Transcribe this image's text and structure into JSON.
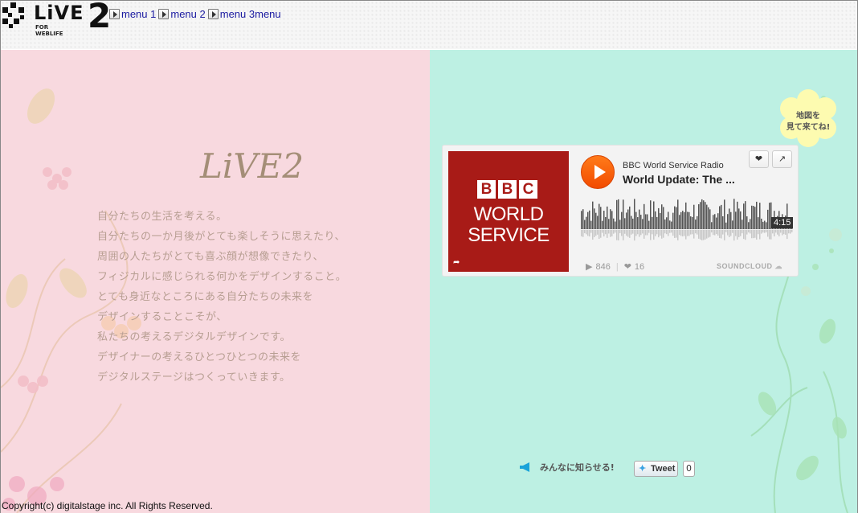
{
  "logo": {
    "live": "LiVE",
    "two": "2",
    "tagline": "FOR WEBLIFE"
  },
  "nav": [
    {
      "label": "menu 1"
    },
    {
      "label": "menu 2"
    },
    {
      "label": "menu 3menu"
    }
  ],
  "main": {
    "title": "LiVE2",
    "intro": [
      "自分たちの生活を考える。",
      "自分たちの一か月後がとても楽しそうに思えたり、",
      "周囲の人たちがとても喜ぶ顔が想像できたり、",
      "フィジカルに感じられる何かをデザインすること。",
      "とても身近なところにある自分たちの未来を",
      "デザインすることこそが、",
      "私たちの考えるデジタルデザインです。",
      "デザイナーの考えるひとつひとつの未来を",
      "デジタルステージはつくっていきます。"
    ]
  },
  "map_badge": {
    "line1": "地図を",
    "line2": "見て来てね!"
  },
  "player": {
    "artwork": {
      "bbc": [
        "B",
        "B",
        "C"
      ],
      "line1": "WORLD",
      "line2": "SERVICE"
    },
    "uploader": "BBC World Service Radio",
    "track_title": "World Update: The ...",
    "duration": "4:15",
    "plays": "846",
    "likes": "16",
    "brand": "SOUNDCLOUD",
    "played_fraction": 0
  },
  "social": {
    "share_label": "みんなに知らせる!",
    "tweet_label": "Tweet",
    "tweet_count": "0"
  },
  "footer": {
    "copyright": "Copyright(c) digitalstage inc. All Rights Reserved."
  },
  "colors": {
    "left_bg": "#f8d9df",
    "right_bg": "#bdf0e3",
    "soundcloud_orange": "#ff5500",
    "title": "#a48e77"
  }
}
